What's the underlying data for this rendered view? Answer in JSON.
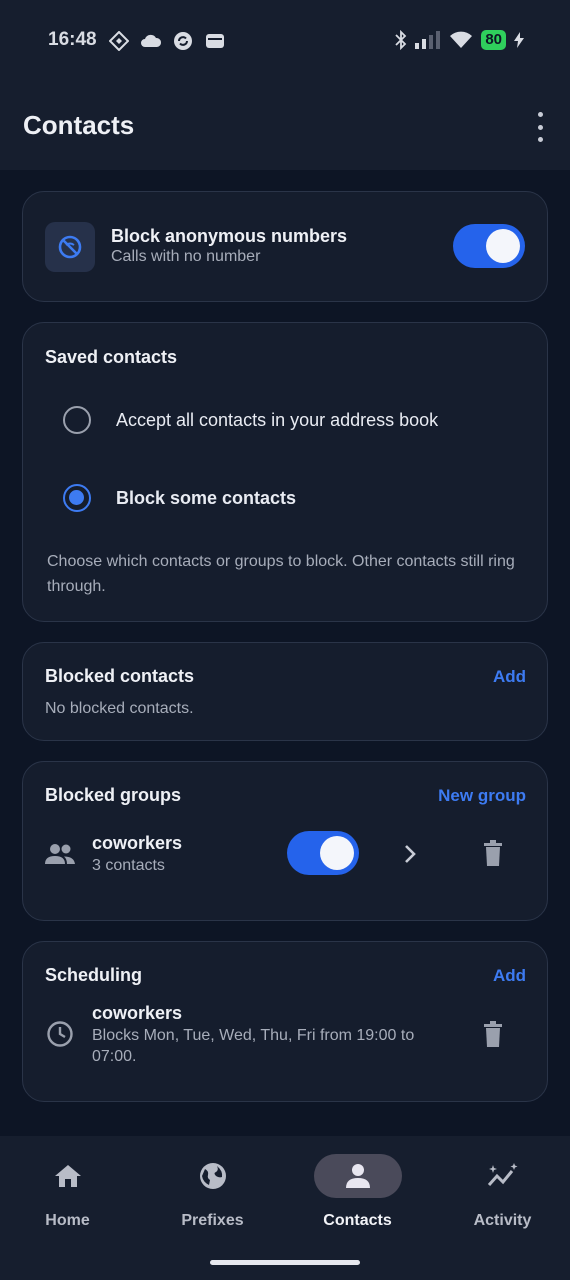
{
  "status_bar": {
    "time": "16:48",
    "battery": "80"
  },
  "app_bar": {
    "title": "Contacts"
  },
  "anonymous": {
    "title": "Block anonymous numbers",
    "subtitle": "Calls with no number",
    "enabled": true
  },
  "saved_contacts": {
    "title": "Saved contacts",
    "options": [
      {
        "label": "Accept all contacts in your address book",
        "selected": false
      },
      {
        "label": "Block some contacts",
        "selected": true
      }
    ],
    "description": "Choose which contacts or groups to block. Other contacts still ring through."
  },
  "blocked_contacts": {
    "title": "Blocked contacts",
    "action": "Add",
    "empty_text": "No blocked contacts."
  },
  "blocked_groups": {
    "title": "Blocked groups",
    "action": "New group",
    "groups": [
      {
        "name": "coworkers",
        "count": "3 contacts",
        "enabled": true
      }
    ]
  },
  "scheduling": {
    "title": "Scheduling",
    "action": "Add",
    "items": [
      {
        "name": "coworkers",
        "description": "Blocks Mon, Tue, Wed, Thu, Fri from 19:00 to 07:00."
      }
    ]
  },
  "bottom_nav": {
    "items": [
      {
        "label": "Home",
        "icon": "home-icon",
        "active": false
      },
      {
        "label": "Prefixes",
        "icon": "globe-icon",
        "active": false
      },
      {
        "label": "Contacts",
        "icon": "person-icon",
        "active": true
      },
      {
        "label": "Activity",
        "icon": "activity-icon",
        "active": false
      }
    ]
  },
  "colors": {
    "accent": "#2563eb",
    "link": "#3d7bf2",
    "background": "#0d1525",
    "card": "#151d2d"
  }
}
